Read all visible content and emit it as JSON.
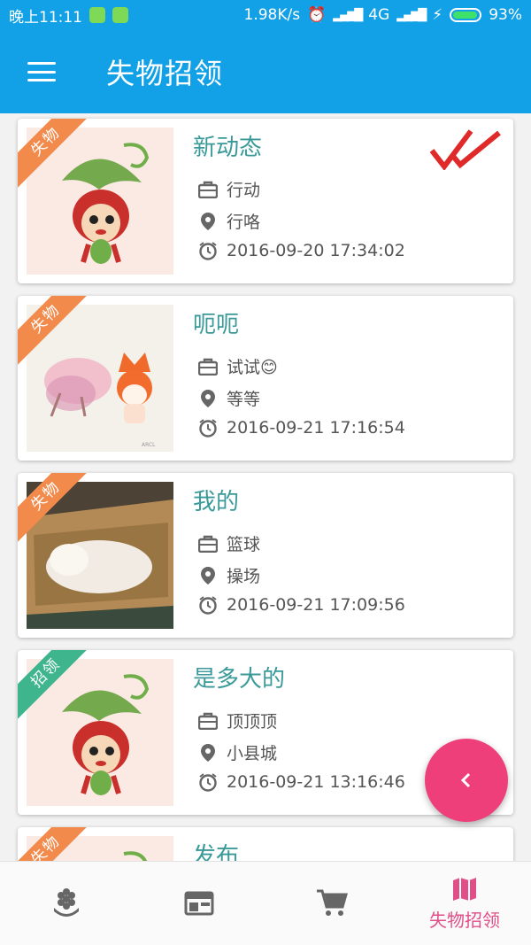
{
  "status_bar": {
    "time": "晚上11:11",
    "speed": "1.98K/s",
    "network": "4G",
    "battery": "93%"
  },
  "app_bar": {
    "title": "失物招领",
    "menu_icon": "menu-icon"
  },
  "items": [
    {
      "tag": "失物",
      "tag_color": "#f28a4b",
      "title": "新动态",
      "item": "行动",
      "location": "行咯",
      "time": "2016-09-20 17:34:02",
      "image": "cartoon-fox-leaf-hat",
      "checked": true
    },
    {
      "tag": "失物",
      "tag_color": "#f28a4b",
      "title": "呃呃",
      "item": "试试😊",
      "location": "等等",
      "time": "2016-09-21 17:16:54",
      "image": "watercolor-fox-sketch",
      "checked": false
    },
    {
      "tag": "失物",
      "tag_color": "#f28a4b",
      "title": "我的",
      "item": "篮球",
      "location": "操场",
      "time": "2016-09-21 17:09:56",
      "image": "cat-in-box-photo",
      "checked": false
    },
    {
      "tag": "招领",
      "tag_color": "#3fb58e",
      "title": "是多大的",
      "item": "顶顶顶",
      "location": "小县城",
      "time": "2016-09-21 13:16:46",
      "image": "cartoon-fox-leaf-hat",
      "checked": false
    },
    {
      "tag": "失物",
      "tag_color": "#f28a4b",
      "title": "发布",
      "item": "",
      "location": "",
      "time": "",
      "image": "cartoon-fox-leaf-hat",
      "checked": false
    }
  ],
  "bottom_nav": [
    {
      "icon": "flower-icon",
      "label": "",
      "active": false
    },
    {
      "icon": "web-layout-icon",
      "label": "",
      "active": false
    },
    {
      "icon": "cart-icon",
      "label": "",
      "active": false
    },
    {
      "icon": "map-icon",
      "label": "失物招领",
      "active": true
    }
  ],
  "fab": {
    "icon": "chevron-left-icon"
  },
  "colors": {
    "primary": "#12a1e6",
    "accent": "#ee3f7b",
    "title_text": "#3a9a9a",
    "lost_tag": "#f28a4b",
    "found_tag": "#3fb58e"
  }
}
